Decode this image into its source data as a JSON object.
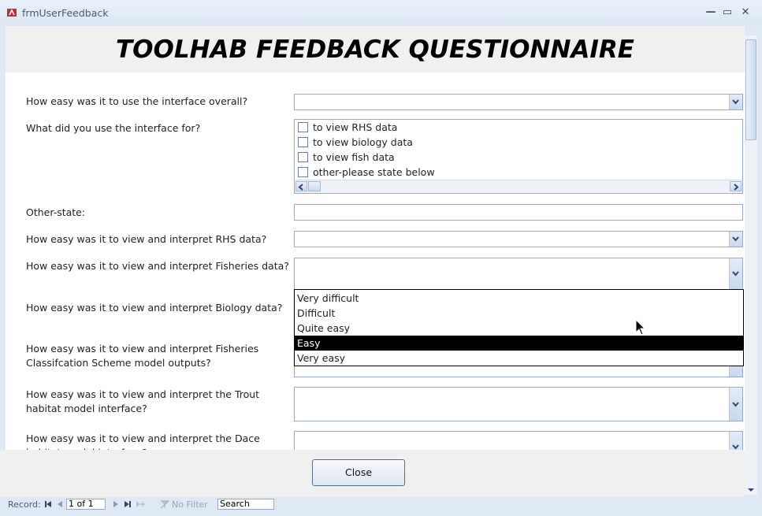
{
  "window": {
    "title": "frmUserFeedback",
    "controls": {
      "minimize": "—",
      "maximize": "▭",
      "close": "✕"
    }
  },
  "form": {
    "title": "TOOLHAB FEEDBACK QUESTIONNAIRE",
    "questions": {
      "q1": "How easy was it to use the interface overall?",
      "q2": "What did you use the interface for?",
      "q3": "Other-state:",
      "q4": "How easy was it to view and interpret RHS data?",
      "q5": "How easy was it to view and interpret Fisheries data?",
      "q6": "How easy was it to view and interpret Biology data?",
      "q7": "How easy was it to view and interpret Fisheries Classifcation Scheme model outputs?",
      "q8": "How easy was it to view and interpret the Trout habitat model interface?",
      "q9": "How easy was it to view and interpret the Dace habitat model interface?"
    },
    "usage_options": [
      "to view RHS data",
      "to view biology data",
      "to view fish data",
      "other-please state below"
    ],
    "dropdown_options": [
      "Very difficult",
      "Difficult",
      "Quite easy",
      "Easy",
      "Very easy"
    ],
    "dropdown_selected": "Easy",
    "close_label": "Close"
  },
  "navigation": {
    "record_label": "Record:",
    "record_value": "1 of 1",
    "filter_label": "No Filter",
    "search_value": "Search"
  },
  "colors": {
    "accent": "#9aaac0",
    "selection": "#000000",
    "chrome": "#dfe8f5"
  }
}
